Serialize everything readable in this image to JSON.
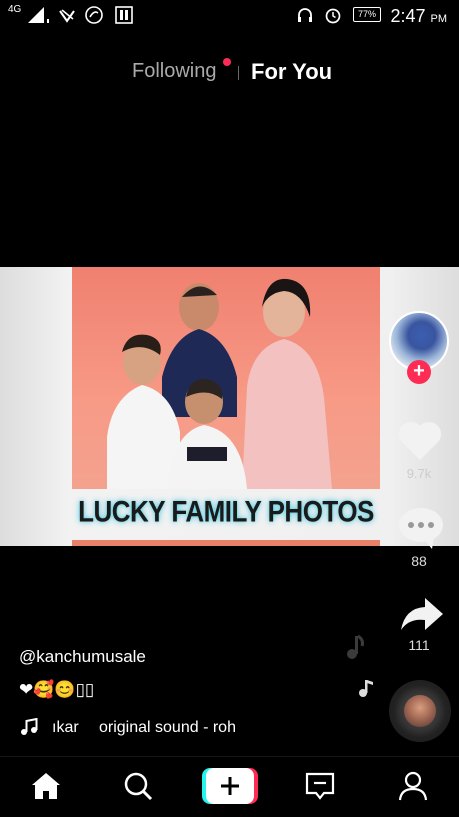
{
  "status_bar": {
    "network": "4G",
    "battery": "77%",
    "time": "2:47",
    "ampm": "PM"
  },
  "tabs": {
    "following": "Following",
    "for_you": "For You"
  },
  "video": {
    "overlay_text": "LUCKY FAMILY PHOTOS"
  },
  "actions": {
    "likes": "9.7k",
    "comments": "88",
    "shares": "111"
  },
  "post": {
    "username": "@kanchumusale",
    "description": "❤🥰😊▯▯",
    "sound_owner": "ıkar",
    "sound_name": "original sound - roh"
  },
  "colors": {
    "accent": "#fe2c55",
    "add_left": "#25f4ee",
    "add_right": "#fe2c55"
  },
  "icons": {
    "home": "home-icon",
    "search": "search-icon",
    "add": "plus-icon",
    "inbox": "inbox-icon",
    "me": "profile-icon"
  }
}
